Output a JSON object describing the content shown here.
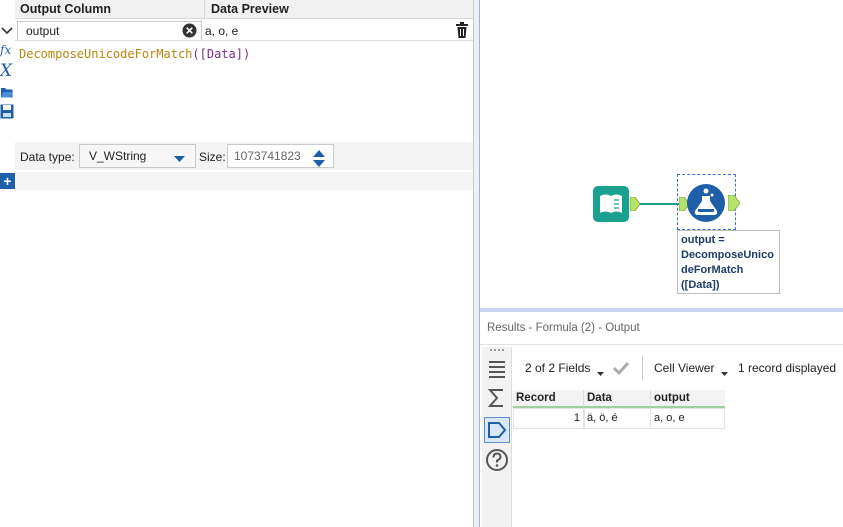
{
  "formula": {
    "headers": {
      "output_column": "Output Column",
      "data_preview": "Data Preview"
    },
    "output_field": "output",
    "preview_value": "a, o, e",
    "expression": {
      "func": "DecomposeUnicodeForMatch",
      "open": "(",
      "field": "[Data]",
      "close": ")"
    },
    "gutter_labels": {
      "fx": "fx",
      "x": "X"
    },
    "data_type_label": "Data type:",
    "data_type_value": "V_WString",
    "size_label": "Size:",
    "size_value": "1073741823",
    "add_label": "+"
  },
  "canvas": {
    "annotation": {
      "line1": "output =",
      "line2": "DecomposeUnico",
      "line3": "deForMatch",
      "line4": "([Data])"
    }
  },
  "results": {
    "title": "Results - Formula (2) - Output",
    "fields_label": "2 of 2 Fields",
    "cell_viewer_label": "Cell Viewer",
    "records_label": "1 record displayed",
    "columns": [
      "Record",
      "Data",
      "output"
    ],
    "rows": [
      {
        "record": "1",
        "data": "ä, ö, é",
        "output": "a, o, e"
      }
    ]
  },
  "colors": {
    "accent_blue": "#1f5fa8",
    "tool_teal": "#1aa08f",
    "connector_green": "#b7e26b",
    "selection_blue": "#3d6fd6"
  },
  "icons": [
    "chevron-down-icon",
    "clear-icon",
    "trash-icon",
    "fx-icon",
    "variable-icon",
    "open-folder-icon",
    "save-icon",
    "add-icon",
    "input-book-icon",
    "formula-flask-icon",
    "fields-menu-icon",
    "checkmark-icon",
    "cell-viewer-menu-icon",
    "table-icon",
    "sum-icon",
    "tag-icon",
    "help-icon"
  ]
}
